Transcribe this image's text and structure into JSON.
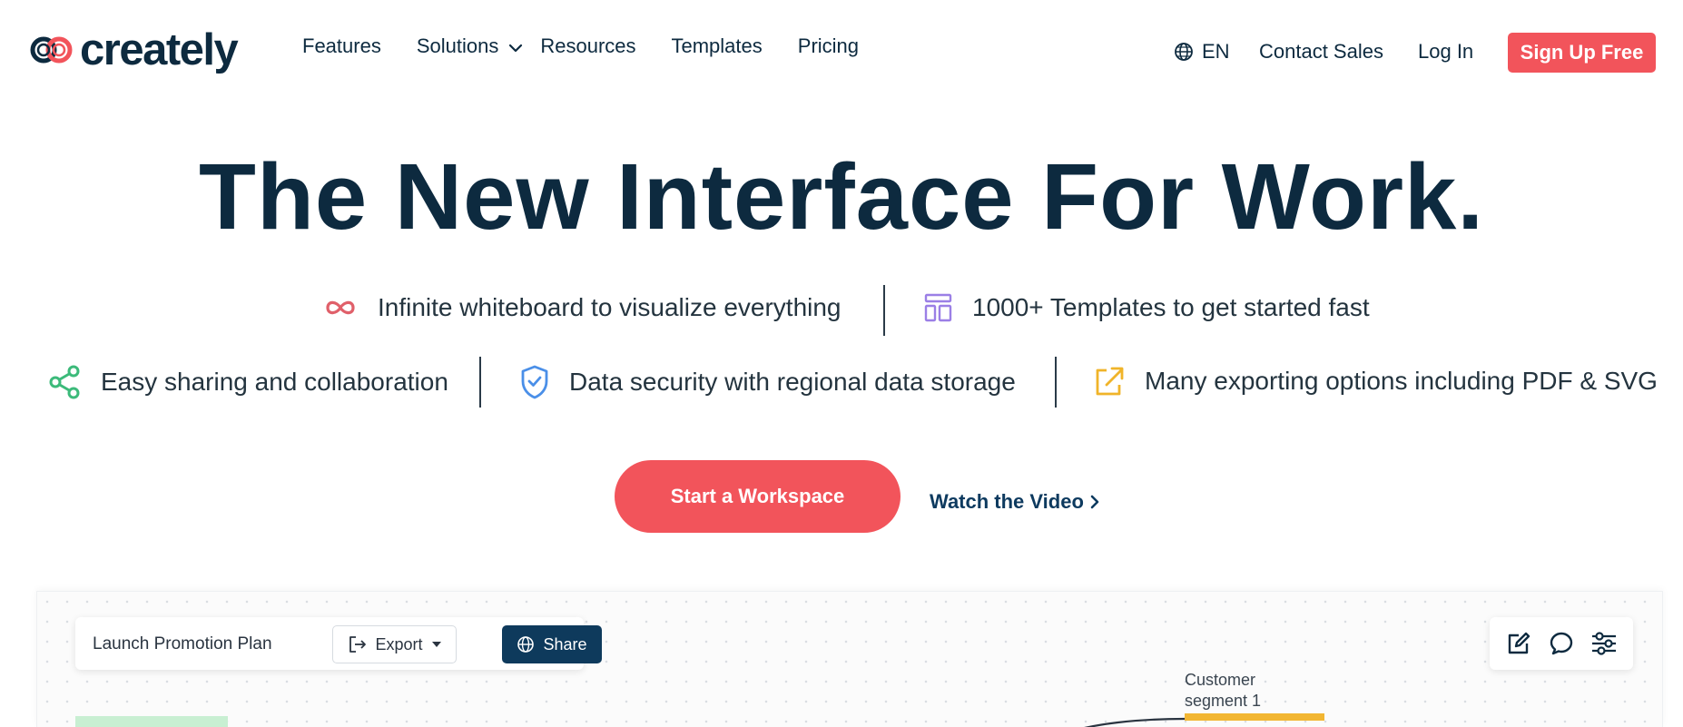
{
  "brand": {
    "name": "creately",
    "accent": "#f2545b",
    "navy": "#0d2a3f"
  },
  "nav": {
    "links": [
      "Features",
      "Solutions",
      "Resources",
      "Templates",
      "Pricing"
    ],
    "language": "EN",
    "contact": "Contact Sales",
    "login": "Log In",
    "signup": "Sign Up Free"
  },
  "hero": {
    "title": "The New Interface For Work.",
    "features": [
      {
        "icon": "infinity-icon",
        "text": "Infinite whiteboard to visualize everything",
        "color": "#e0606a"
      },
      {
        "icon": "templates-icon",
        "text": "1000+ Templates to get started fast",
        "color": "#9b7fe6"
      },
      {
        "icon": "share-nodes-icon",
        "text": "Easy sharing and collaboration",
        "color": "#3cba7a"
      },
      {
        "icon": "shield-check-icon",
        "text": "Data security with regional data storage",
        "color": "#4a8fe8"
      },
      {
        "icon": "external-link-icon",
        "text": "Many exporting options including PDF & SVG",
        "color": "#f0b429"
      }
    ]
  },
  "cta": {
    "primary": "Start a Workspace",
    "secondary": "Watch the Video"
  },
  "preview": {
    "doc_title": "Launch Promotion Plan",
    "export_label": "Export",
    "share_label": "Share",
    "segment_label_line1": "Customer",
    "segment_label_line2": "segment 1"
  }
}
